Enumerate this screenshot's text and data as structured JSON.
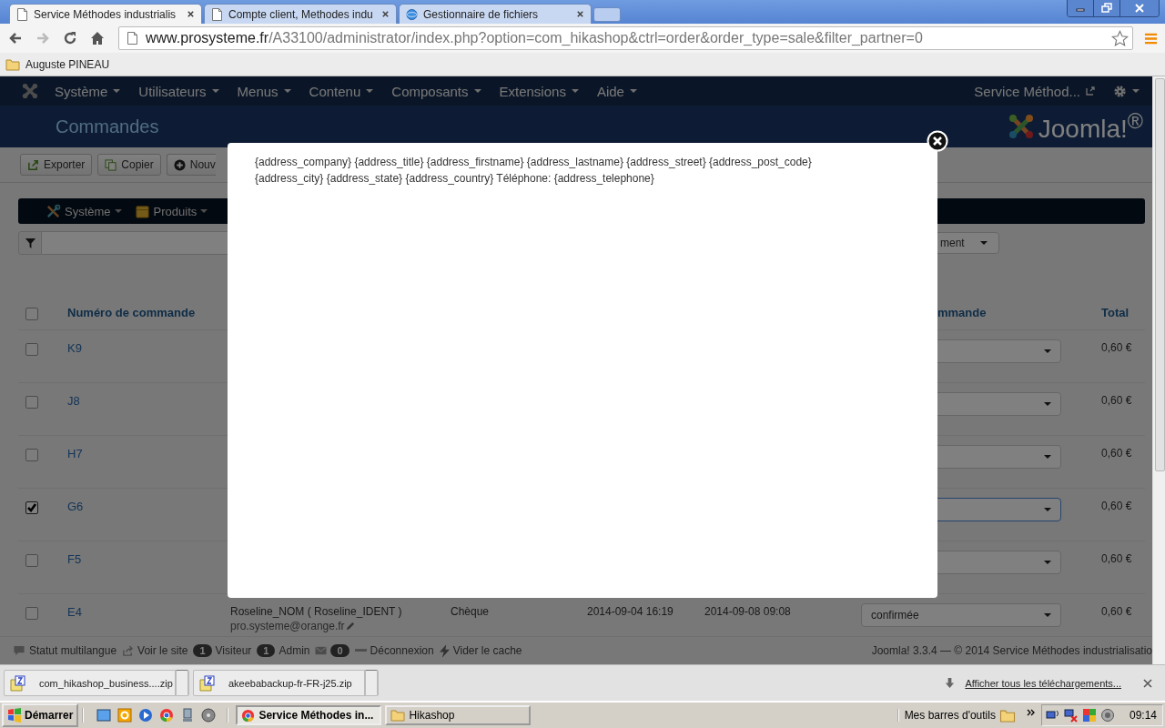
{
  "browser": {
    "tabs": [
      {
        "title": "Service Méthodes industrialis",
        "selected": true
      },
      {
        "title": "Compte client, Methodes indu",
        "selected": false
      },
      {
        "title": "Gestionnaire de fichiers",
        "selected": false
      }
    ],
    "url": {
      "host": "www.prosysteme.fr",
      "path": "/A33100/administrator/index.php?option=com_hikashop&ctrl=order&order_type=sale&filter_partner=0"
    },
    "bookmarks": [
      "Auguste PINEAU"
    ]
  },
  "admin_menu": {
    "items": [
      "Système",
      "Utilisateurs",
      "Menus",
      "Contenu",
      "Composants",
      "Extensions",
      "Aide"
    ],
    "site_link": "Service Méthod..."
  },
  "page_header": {
    "title": "Commandes",
    "logo": "Joomla!$^{®}$"
  },
  "toolbar": [
    "Exporter",
    "Copier",
    "Nouv"
  ],
  "submenu": [
    "Système",
    "Produits"
  ],
  "filter": {
    "select_fragment": "ment"
  },
  "table": {
    "all_selected": false,
    "columns": [
      "Numéro de commande",
      "mmande",
      "Total"
    ],
    "rows": [
      {
        "number": "K9",
        "selected": false,
        "focused": false,
        "total": "0,60 €"
      },
      {
        "number": "J8",
        "selected": false,
        "focused": false,
        "total": "0,60 €"
      },
      {
        "number": "H7",
        "selected": false,
        "focused": false,
        "total": "0,60 €"
      },
      {
        "number": "G6",
        "selected": true,
        "focused": true,
        "total": "0,60 €"
      },
      {
        "number": "F5",
        "selected": false,
        "focused": false,
        "total": "0,60 €"
      },
      {
        "number": "E4",
        "selected": false,
        "focused": false,
        "customer": "Roseline_NOM ( Roseline_IDENT )",
        "email": "pro.systeme@orange.fr",
        "payment": "Chèque",
        "created": "2014-09-04 16:19",
        "modified": "2014-09-08 09:08",
        "status": "confirmée",
        "total": "0,60 €"
      }
    ]
  },
  "status_bar": {
    "items": [
      {
        "label": "Statut multilangue"
      },
      {
        "label": "Voir le site"
      },
      {
        "count": "1",
        "label": "Visiteur"
      },
      {
        "count": "1",
        "label": "Admin"
      },
      {
        "count": "0"
      },
      {
        "label": "Déconnexion"
      },
      {
        "label": "Vider le cache"
      }
    ],
    "copyright": "Joomla! 3.3.4 — © 2014 Service Méthodes industrialisatio"
  },
  "modal": {
    "text": "{address_company} {address_title} {address_firstname} {address_lastname} {address_street} {address_post_code} {address_city} {address_state} {address_country} Téléphone: {address_telephone}"
  },
  "downloads": {
    "files": [
      "com_hikashop_business....zip",
      "akeebabackup-fr-FR-j25.zip"
    ],
    "show_all": "Afficher tous les téléchargements..."
  },
  "taskbar": {
    "start": "Démarrer",
    "windows": [
      {
        "title": "Service Méthodes in...",
        "selected": true
      },
      {
        "title": "Hikashop",
        "selected": false
      }
    ],
    "toolbars": "Mes barres d'outils",
    "clock": "09:14"
  }
}
